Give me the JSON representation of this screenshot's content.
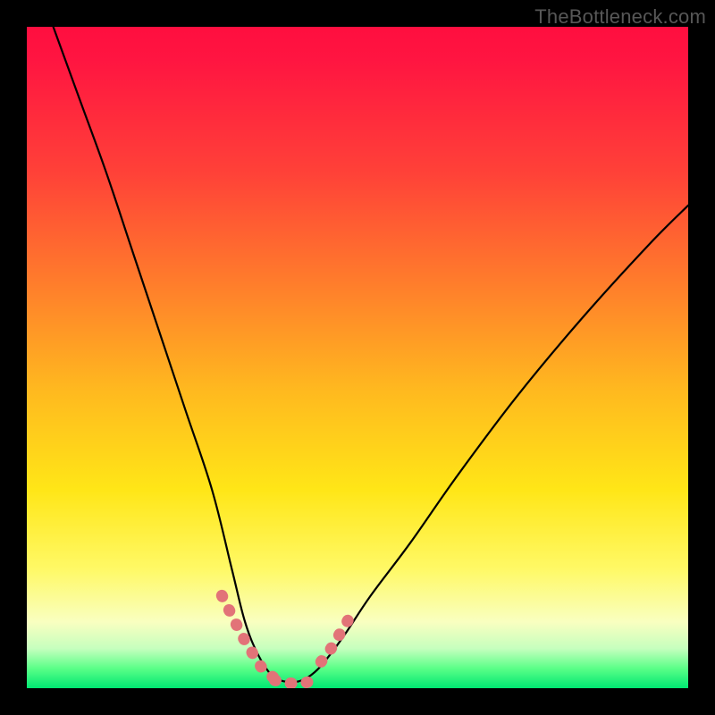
{
  "watermark": "TheBottleneck.com",
  "chart_data": {
    "type": "line",
    "title": "",
    "xlabel": "",
    "ylabel": "",
    "xlim": [
      0,
      100
    ],
    "ylim": [
      0,
      100
    ],
    "series": [
      {
        "name": "bottleneck-curve",
        "stroke": "#000000",
        "x": [
          4,
          8,
          12,
          16,
          20,
          24,
          28,
          31,
          33,
          35,
          37,
          39,
          41,
          43,
          45,
          48,
          52,
          58,
          65,
          74,
          84,
          94,
          100
        ],
        "y": [
          100,
          89,
          78,
          66,
          54,
          42,
          30,
          18,
          10,
          5,
          2,
          1,
          1,
          2,
          4,
          8,
          14,
          22,
          32,
          44,
          56,
          67,
          73
        ]
      }
    ],
    "highlight_segments": [
      {
        "name": "left-descent-highlight",
        "stroke": "#e27378",
        "x": [
          29.5,
          31.0,
          32.5,
          34.0,
          35.0,
          36.0,
          37.5,
          39.0
        ],
        "y": [
          14.0,
          11.0,
          8.0,
          5.5,
          3.8,
          2.5,
          1.5,
          1.0
        ]
      },
      {
        "name": "right-ascent-highlight",
        "stroke": "#e27378",
        "x": [
          44.5,
          46.0,
          47.5,
          49.0
        ],
        "y": [
          4.0,
          6.0,
          8.5,
          11.0
        ]
      },
      {
        "name": "valley-floor-highlight",
        "stroke": "#e27378",
        "x": [
          37.5,
          39.0,
          40.5,
          42.0,
          43.5
        ],
        "y": [
          1.2,
          0.8,
          0.7,
          0.8,
          1.2
        ]
      }
    ],
    "gradient_stops": [
      {
        "pos": 0,
        "color": "#ff0e3f"
      },
      {
        "pos": 22,
        "color": "#ff4138"
      },
      {
        "pos": 38,
        "color": "#ff7a2c"
      },
      {
        "pos": 55,
        "color": "#ffb91f"
      },
      {
        "pos": 70,
        "color": "#ffe617"
      },
      {
        "pos": 90,
        "color": "#f9ffc0"
      },
      {
        "pos": 100,
        "color": "#00e772"
      }
    ]
  }
}
